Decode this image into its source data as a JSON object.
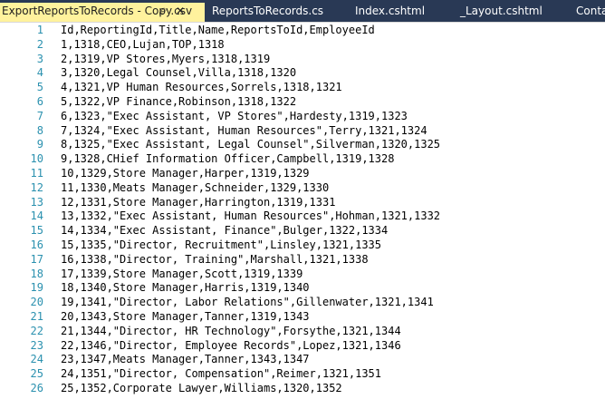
{
  "tabs": [
    {
      "label": "ExportReportsToRecords - Copy.csv",
      "active": true
    },
    {
      "label": "ReportsToRecords.cs",
      "active": false
    },
    {
      "label": "Index.cshtml",
      "active": false
    },
    {
      "label": "_Layout.cshtml",
      "active": false
    },
    {
      "label": "Conta",
      "active": false
    }
  ],
  "active_tab": {
    "pin_icon": "pin-icon",
    "close_icon": "close-icon"
  },
  "editor": {
    "lines": [
      {
        "n": "1",
        "text": "Id,ReportingId,Title,Name,ReportsToId,EmployeeId"
      },
      {
        "n": "2",
        "text": "1,1318,CEO,Lujan,TOP,1318"
      },
      {
        "n": "3",
        "text": "2,1319,VP Stores,Myers,1318,1319"
      },
      {
        "n": "4",
        "text": "3,1320,Legal Counsel,Villa,1318,1320"
      },
      {
        "n": "5",
        "text": "4,1321,VP Human Resources,Sorrels,1318,1321"
      },
      {
        "n": "6",
        "text": "5,1322,VP Finance,Robinson,1318,1322"
      },
      {
        "n": "7",
        "text": "6,1323,\"Exec Assistant, VP Stores\",Hardesty,1319,1323"
      },
      {
        "n": "8",
        "text": "7,1324,\"Exec Assistant, Human Resources\",Terry,1321,1324"
      },
      {
        "n": "9",
        "text": "8,1325,\"Exec Assistant, Legal Counsel\",Silverman,1320,1325"
      },
      {
        "n": "10",
        "text": "9,1328,CHief Information Officer,Campbell,1319,1328"
      },
      {
        "n": "11",
        "text": "10,1329,Store Manager,Harper,1319,1329"
      },
      {
        "n": "12",
        "text": "11,1330,Meats Manager,Schneider,1329,1330"
      },
      {
        "n": "13",
        "text": "12,1331,Store Manager,Harrington,1319,1331"
      },
      {
        "n": "14",
        "text": "13,1332,\"Exec Assistant, Human Resources\",Hohman,1321,1332"
      },
      {
        "n": "15",
        "text": "14,1334,\"Exec Assistant, Finance\",Bulger,1322,1334"
      },
      {
        "n": "16",
        "text": "15,1335,\"Director, Recruitment\",Linsley,1321,1335"
      },
      {
        "n": "17",
        "text": "16,1338,\"Director, Training\",Marshall,1321,1338"
      },
      {
        "n": "18",
        "text": "17,1339,Store Manager,Scott,1319,1339"
      },
      {
        "n": "19",
        "text": "18,1340,Store Manager,Harris,1319,1340"
      },
      {
        "n": "20",
        "text": "19,1341,\"Director, Labor Relations\",Gillenwater,1321,1341"
      },
      {
        "n": "21",
        "text": "20,1343,Store Manager,Tanner,1319,1343"
      },
      {
        "n": "22",
        "text": "21,1344,\"Director, HR Technology\",Forsythe,1321,1344"
      },
      {
        "n": "23",
        "text": "22,1346,\"Director, Employee Records\",Lopez,1321,1346"
      },
      {
        "n": "24",
        "text": "23,1347,Meats Manager,Tanner,1343,1347"
      },
      {
        "n": "25",
        "text": "24,1351,\"Director, Compensation\",Reimer,1321,1351"
      },
      {
        "n": "26",
        "text": "25,1352,Corporate Lawyer,Williams,1320,1352"
      }
    ]
  },
  "colors": {
    "tab_strip_bg": "#293955",
    "active_tab_bg": "#fff29d",
    "line_number": "#2b91af",
    "code_text": "#000000"
  }
}
